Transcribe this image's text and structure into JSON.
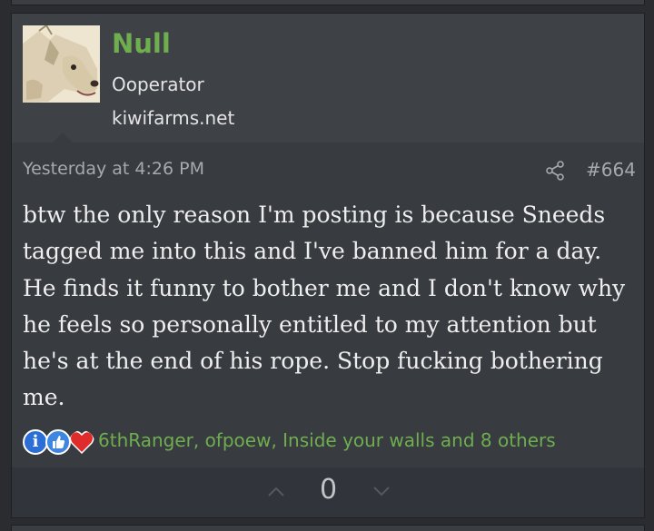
{
  "post": {
    "author": {
      "username": "Null",
      "title": "Ooperator",
      "site": "kiwifarms.net",
      "avatar_icon": "dog-avatar"
    },
    "date": "Yesterday at 4:26 PM",
    "share_icon": "share-icon",
    "number": "#664",
    "body": "btw the only reason I'm posting is because Sneeds tagged me into this and I've banned him for a day. He finds it funny to bother me and I don't know why he feels so personally entitled to my attention but he's at the end of his rope. Stop fucking bothering me.",
    "reactions": {
      "icons": [
        "informative-icon",
        "like-icon",
        "love-icon"
      ],
      "info_glyph": "i",
      "users": "6thRanger, ofpoew, Inside your walls and 8 others"
    },
    "votes": {
      "count": "0"
    }
  },
  "colors": {
    "background": "#2a2c30",
    "post_bg": "#383b40",
    "user_block_bg": "#3e4146",
    "username": "#6fae4f",
    "link_green": "#6fae4f",
    "body_text": "#eeeeee",
    "muted_text": "#a7a9ad",
    "vote_bar": "#31343a"
  }
}
